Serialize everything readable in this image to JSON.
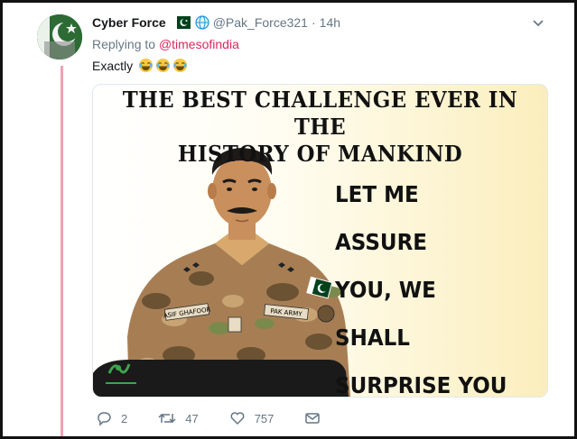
{
  "tweet": {
    "display_name": "Cyber Force",
    "handle": "@Pak_Force321",
    "time": "14h",
    "replying_prefix": "Replying to",
    "replying_to": "@timesofindia",
    "text": "Exactly",
    "emoji_count_note": "three laughing emojis",
    "icons": [
      "pakistan-flag-icon",
      "globe-icon",
      "chevron-down-icon"
    ]
  },
  "media": {
    "title_line1": "THE BEST CHALLENGE EVER IN THE",
    "title_line2": "HISTORY OF MANKIND",
    "quote_line1": "LET ME ASSURE",
    "quote_line2": "YOU, WE SHALL",
    "quote_line3": "SURPRISE YOU",
    "name_tag": "ASIF GHAFOOR",
    "army_tag": "PAK ARMY"
  },
  "actions": {
    "replies": "2",
    "retweets": "47",
    "likes": "757"
  },
  "colors": {
    "thread_line": "#f3a0b1",
    "mention": "#e0245e",
    "meta_gray": "#657786"
  }
}
